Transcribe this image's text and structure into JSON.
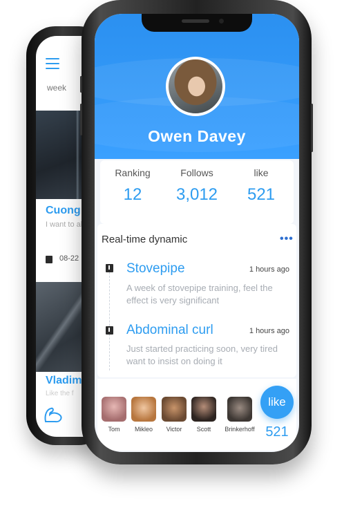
{
  "back_screen": {
    "week_label": "week",
    "post1": {
      "name": "Cuong",
      "desc": "I want to al fitness",
      "date": "08-22"
    },
    "post2": {
      "name": "Vladim",
      "desc": "Like the f"
    }
  },
  "profile": {
    "name": "Owen Davey",
    "avatar_alt": "profile photo"
  },
  "stats": [
    {
      "label": "Ranking",
      "value": "12"
    },
    {
      "label": "Follows",
      "value": "3,012"
    },
    {
      "label": "like",
      "value": "521"
    }
  ],
  "dynamic": {
    "title": "Real-time dynamic",
    "more_icon": "•••",
    "posts": [
      {
        "title": "Stovepipe",
        "time": "1 hours ago",
        "text": "A week of stovepipe training, feel the effect is very significant"
      },
      {
        "title": "Abdominal curl",
        "time": "1 hours ago",
        "text": "Just started practicing soon, very tired want to insist on doing it"
      }
    ]
  },
  "likers": [
    {
      "name": "Tom"
    },
    {
      "name": "Mikleo"
    },
    {
      "name": "Victor"
    },
    {
      "name": "Scott"
    },
    {
      "name": "Brinkerhoff"
    }
  ],
  "like_button": {
    "label": "like",
    "count": "521"
  },
  "colors": {
    "accent": "#2d9cf0",
    "header": "#3aa0ff"
  }
}
